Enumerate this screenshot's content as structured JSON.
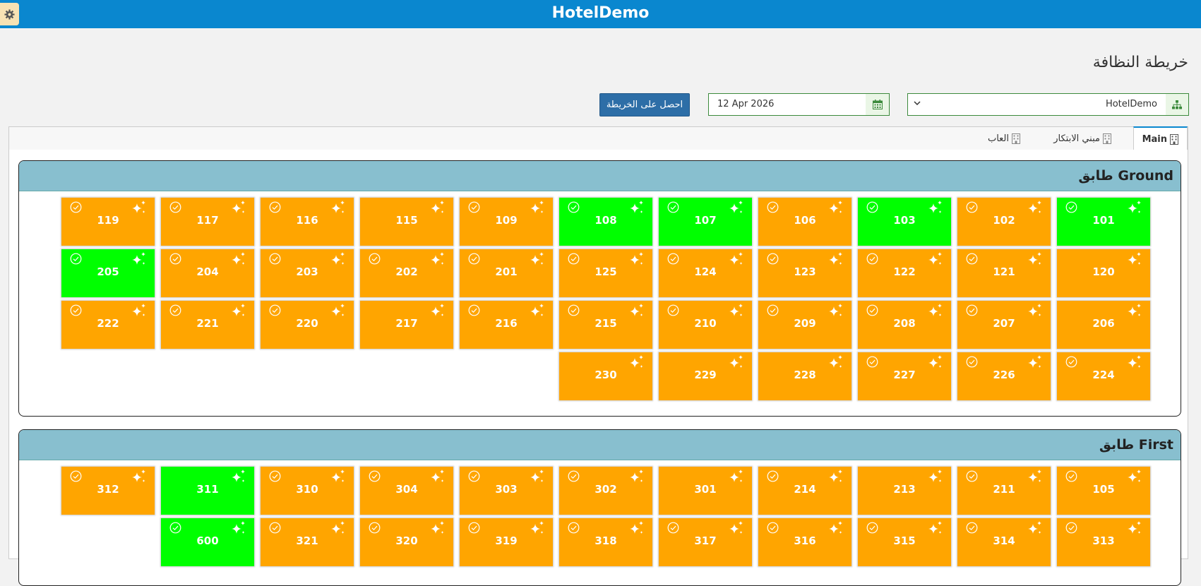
{
  "header": {
    "title": "HotelDemo"
  },
  "page": {
    "title": "خريطة النظافة"
  },
  "filters": {
    "hotel": "HotelDemo",
    "date": "12 Apr 2026",
    "get_map_label": "احصل على الخريطة"
  },
  "tabs": [
    {
      "label": "Main",
      "active": true
    },
    {
      "label": "مبني الابتكار",
      "active": false
    },
    {
      "label": "العاب",
      "active": false
    }
  ],
  "colors": {
    "clean": "#00ff00",
    "dirty": "#ffa500",
    "accent": "#0a87cf",
    "floor_header": "#88bfcf"
  },
  "icons": {
    "check": "check-circle-icon",
    "clean": "sparkle-icon",
    "settings": "gear-icon",
    "hotel": "sitemap-icon",
    "calendar": "calendar-icon",
    "building": "building-icon"
  },
  "floors": [
    {
      "title": "طابق Ground",
      "rows": [
        [
          {
            "number": "101",
            "status": "clean",
            "check": true
          },
          {
            "number": "102",
            "status": "dirty",
            "check": true
          },
          {
            "number": "103",
            "status": "clean",
            "check": true
          },
          {
            "number": "106",
            "status": "dirty",
            "check": true
          },
          {
            "number": "107",
            "status": "clean",
            "check": true
          },
          {
            "number": "108",
            "status": "clean",
            "check": true
          },
          {
            "number": "109",
            "status": "dirty",
            "check": true
          },
          {
            "number": "115",
            "status": "dirty",
            "check": false
          },
          {
            "number": "116",
            "status": "dirty",
            "check": true
          },
          {
            "number": "117",
            "status": "dirty",
            "check": true
          },
          {
            "number": "119",
            "status": "dirty",
            "check": true
          }
        ],
        [
          {
            "number": "120",
            "status": "dirty",
            "check": false
          },
          {
            "number": "121",
            "status": "dirty",
            "check": true
          },
          {
            "number": "122",
            "status": "dirty",
            "check": true
          },
          {
            "number": "123",
            "status": "dirty",
            "check": true
          },
          {
            "number": "124",
            "status": "dirty",
            "check": true
          },
          {
            "number": "125",
            "status": "dirty",
            "check": true
          },
          {
            "number": "201",
            "status": "dirty",
            "check": true
          },
          {
            "number": "202",
            "status": "dirty",
            "check": true
          },
          {
            "number": "203",
            "status": "dirty",
            "check": true
          },
          {
            "number": "204",
            "status": "dirty",
            "check": true
          },
          {
            "number": "205",
            "status": "clean",
            "check": true
          }
        ],
        [
          {
            "number": "206",
            "status": "dirty",
            "check": false
          },
          {
            "number": "207",
            "status": "dirty",
            "check": true
          },
          {
            "number": "208",
            "status": "dirty",
            "check": true
          },
          {
            "number": "209",
            "status": "dirty",
            "check": true
          },
          {
            "number": "210",
            "status": "dirty",
            "check": true
          },
          {
            "number": "215",
            "status": "dirty",
            "check": true
          },
          {
            "number": "216",
            "status": "dirty",
            "check": true
          },
          {
            "number": "217",
            "status": "dirty",
            "check": false
          },
          {
            "number": "220",
            "status": "dirty",
            "check": true
          },
          {
            "number": "221",
            "status": "dirty",
            "check": true
          },
          {
            "number": "222",
            "status": "dirty",
            "check": true
          }
        ],
        [
          {
            "number": "224",
            "status": "dirty",
            "check": true
          },
          {
            "number": "226",
            "status": "dirty",
            "check": true
          },
          {
            "number": "227",
            "status": "dirty",
            "check": true
          },
          {
            "number": "228",
            "status": "dirty",
            "check": false
          },
          {
            "number": "229",
            "status": "dirty",
            "check": false
          },
          {
            "number": "230",
            "status": "dirty",
            "check": false
          }
        ]
      ]
    },
    {
      "title": "طابق First",
      "rows": [
        [
          {
            "number": "105",
            "status": "dirty",
            "check": true
          },
          {
            "number": "211",
            "status": "dirty",
            "check": true
          },
          {
            "number": "213",
            "status": "dirty",
            "check": false
          },
          {
            "number": "214",
            "status": "dirty",
            "check": true
          },
          {
            "number": "301",
            "status": "dirty",
            "check": false
          },
          {
            "number": "302",
            "status": "dirty",
            "check": true
          },
          {
            "number": "303",
            "status": "dirty",
            "check": true
          },
          {
            "number": "304",
            "status": "dirty",
            "check": true
          },
          {
            "number": "310",
            "status": "dirty",
            "check": true
          },
          {
            "number": "311",
            "status": "clean",
            "check": false
          },
          {
            "number": "312",
            "status": "dirty",
            "check": true
          }
        ],
        [
          {
            "number": "313",
            "status": "dirty",
            "check": true
          },
          {
            "number": "314",
            "status": "dirty",
            "check": true
          },
          {
            "number": "315",
            "status": "dirty",
            "check": true
          },
          {
            "number": "316",
            "status": "dirty",
            "check": true
          },
          {
            "number": "317",
            "status": "dirty",
            "check": true
          },
          {
            "number": "318",
            "status": "dirty",
            "check": true
          },
          {
            "number": "319",
            "status": "dirty",
            "check": true
          },
          {
            "number": "320",
            "status": "dirty",
            "check": true
          },
          {
            "number": "321",
            "status": "dirty",
            "check": true
          },
          {
            "number": "600",
            "status": "clean",
            "check": true
          }
        ]
      ]
    }
  ]
}
